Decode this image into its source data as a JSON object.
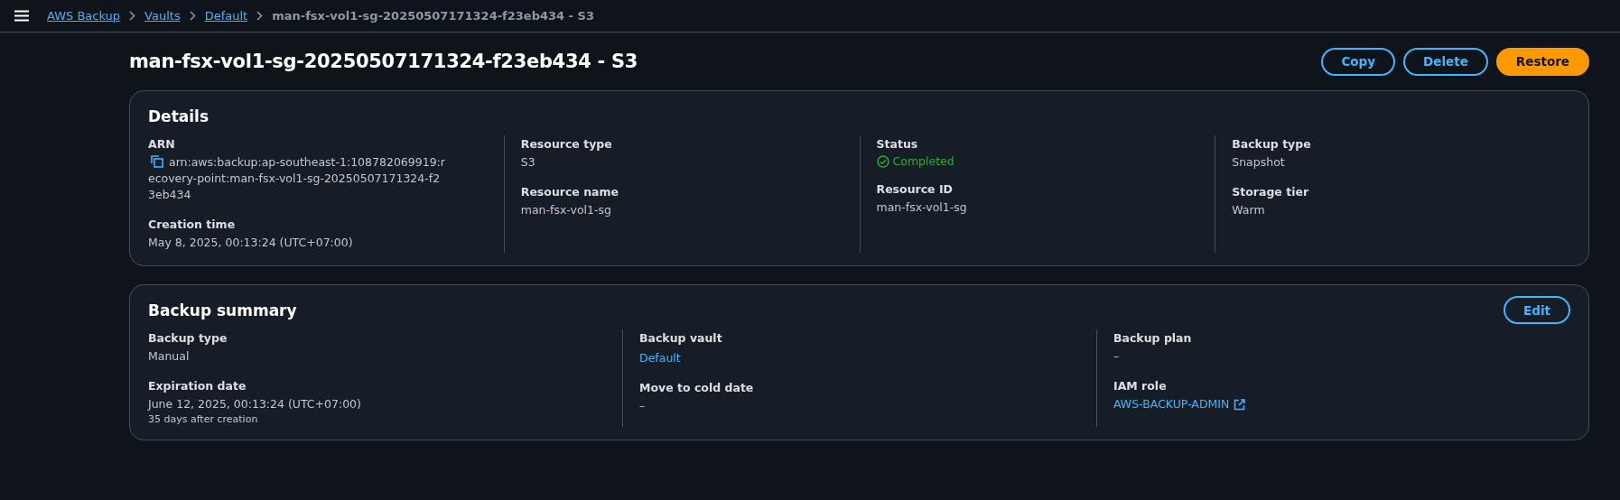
{
  "breadcrumbs": [
    {
      "label": "AWS Backup",
      "kind": "link"
    },
    {
      "label": "Vaults",
      "kind": "link"
    },
    {
      "label": "Default",
      "kind": "link"
    },
    {
      "label": "man-fsx-vol1-sg-20250507171324-f23eb434 - S3",
      "kind": "current"
    }
  ],
  "page_title": "man-fsx-vol1-sg-20250507171324-f23eb434 - S3",
  "actions": [
    {
      "label": "Copy",
      "kind": "normal"
    },
    {
      "label": "Delete",
      "kind": "normal"
    },
    {
      "label": "Restore",
      "kind": "primary"
    }
  ],
  "details": {
    "title": "Details",
    "columns": [
      [
        {
          "label": "ARN",
          "value": "arn:aws:backup:ap-southeast-1:108782069919:recovery-point:man-fsx-vol1-sg-20250507171324-f23eb434",
          "kind": "copy"
        },
        {
          "label": "Creation time",
          "value": "May 8, 2025, 00:13:24 (UTC+07:00)",
          "kind": "text"
        }
      ],
      [
        {
          "label": "Resource type",
          "value": "S3",
          "kind": "text"
        },
        {
          "label": "Resource name",
          "value": "man-fsx-vol1-sg",
          "kind": "text"
        }
      ],
      [
        {
          "label": "Status",
          "value": "Completed",
          "kind": "status"
        },
        {
          "label": "Resource ID",
          "value": "man-fsx-vol1-sg",
          "kind": "text"
        }
      ],
      [
        {
          "label": "Backup type",
          "value": "Snapshot",
          "kind": "text"
        },
        {
          "label": "Storage tier",
          "value": "Warm",
          "kind": "text"
        }
      ]
    ]
  },
  "backup_summary": {
    "title": "Backup summary",
    "action": "Edit",
    "columns": [
      [
        {
          "label": "Backup type",
          "value": "Manual",
          "kind": "text"
        },
        {
          "label": "Expiration date",
          "value": "June 12, 2025, 00:13:24 (UTC+07:00)",
          "note": "35 days after creation",
          "kind": "text"
        }
      ],
      [
        {
          "label": "Backup vault",
          "value": "Default",
          "kind": "link"
        },
        {
          "label": "Move to cold date",
          "value": "–",
          "kind": "text"
        }
      ],
      [
        {
          "label": "Backup plan",
          "value": "–",
          "kind": "text"
        },
        {
          "label": "IAM role",
          "value": "AWS-BACKUP-ADMIN",
          "kind": "external"
        }
      ]
    ]
  }
}
